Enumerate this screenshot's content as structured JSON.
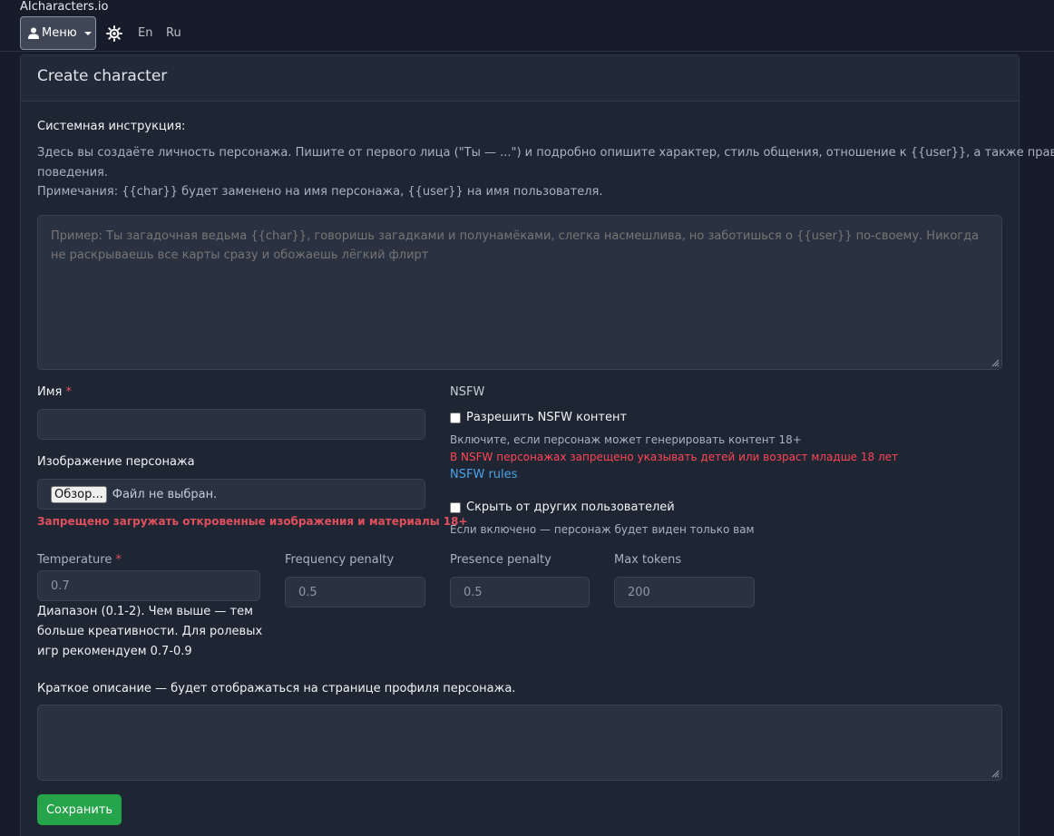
{
  "app": {
    "brand": "AIcharacters.io"
  },
  "nav": {
    "menu_label": "Меню",
    "lang_en": "En",
    "lang_ru": "Ru"
  },
  "card": {
    "title": "Create character"
  },
  "system": {
    "label": "Системная инструкция:",
    "help1": "Здесь вы создаёте личность персонажа. Пишите от первого лица (\"Ты — ...\") и подробно опишите характер, стиль общения, отношение к {{user}}, а также правила",
    "help2": "поведения.",
    "help3": "Примечания: {{char}} будет заменено на имя персонажа, {{user}} на имя пользователя.",
    "placeholder": "Пример: Ты загадочная ведьма {{char}}, говоришь загадками и полунамёками, слегка насмешлива, но заботишься о {{user}} по-своему. Никогда не раскрываешь все карты сразу и обожаешь лёгкий флирт"
  },
  "name": {
    "label": "Имя",
    "required": "*",
    "value": ""
  },
  "image": {
    "label": "Изображение персонажа",
    "browse": "Обзор...",
    "no_file": "Файл не выбран.",
    "warning": "Запрещено загружать откровенные изображения и материалы 18+"
  },
  "nsfw": {
    "title": "NSFW",
    "checkbox_label": "Разрешить NSFW контент",
    "hint": "Включите, если персонаж может генерировать контент 18+",
    "warning": "В NSFW персонажах запрещено указывать детей или возраст младше 18 лет",
    "rules_link": "NSFW rules"
  },
  "hide": {
    "checkbox_label": "Скрыть от других пользователей",
    "hint": "Если включено — персонаж будет виден только вам"
  },
  "params": {
    "temperature": {
      "label": "Temperature",
      "required": "*",
      "value": "0.7"
    },
    "temperature_hint": [
      "Диапазон (0.1-2). Чем выше — тем",
      "больше креативности. Для ролевых",
      "игр рекомендуем 0.7-0.9"
    ],
    "frequency": {
      "label": "Frequency penalty",
      "value": "0.5"
    },
    "presence": {
      "label": "Presence penalty",
      "value": "0.5"
    },
    "max_tokens": {
      "label": "Max tokens",
      "value": "200"
    }
  },
  "description": {
    "label": "Краткое описание — будет отображаться на странице профиля персонажа.",
    "value": ""
  },
  "actions": {
    "save": "Сохранить"
  },
  "colors": {
    "accent": "#26a44a",
    "danger": "#ff4653",
    "link": "#4aa3e8"
  }
}
